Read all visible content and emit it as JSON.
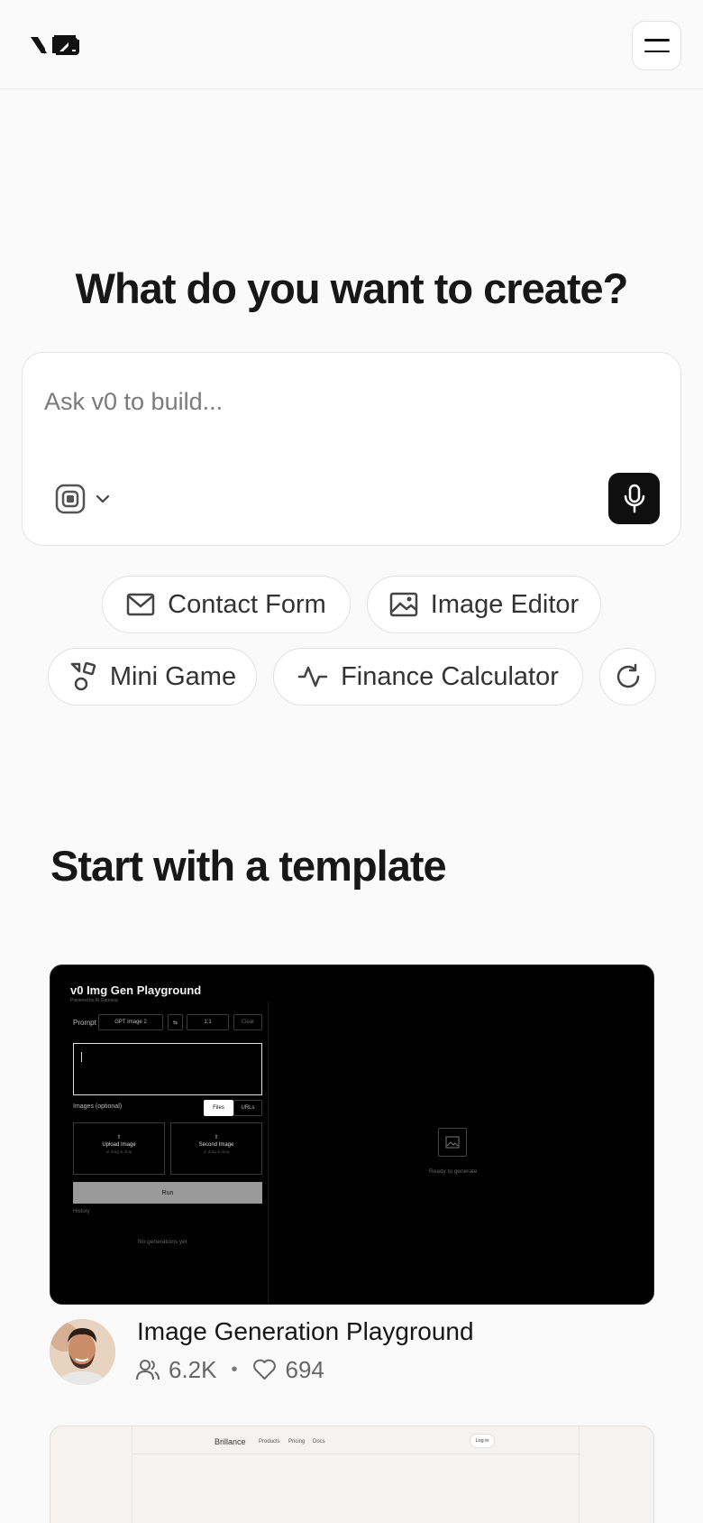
{
  "header": {
    "logo_text": "v0",
    "menu_icon": "hamburger-icon"
  },
  "hero": {
    "title": "What do you want to create?",
    "prompt_placeholder": "Ask v0 to build...",
    "model_icon": "model-selector-icon",
    "mic_icon": "microphone-icon"
  },
  "suggestions": [
    {
      "label": "Contact Form",
      "icon": "mail-icon"
    },
    {
      "label": "Image Editor",
      "icon": "image-icon"
    },
    {
      "label": "Mini Game",
      "icon": "shapes-icon"
    },
    {
      "label": "Finance Calculator",
      "icon": "activity-icon"
    }
  ],
  "refresh_icon": "refresh-icon",
  "templates": {
    "section_title": "Start with a template",
    "cards": [
      {
        "name": "Image Generation Playground",
        "users": "6.2K",
        "likes": "694",
        "preview": {
          "title": "v0 Img Gen Playground",
          "subtitle": "Powered by AI Gateway",
          "prompt_label": "Prompt",
          "model": "GPT Image 2",
          "ratio": "1:1",
          "clear": "Clear",
          "images_label": "Images (optional)",
          "tab_files": "Files",
          "tab_urls": "URLs",
          "upload_1": "Upload Image",
          "upload_2": "Second Image",
          "upload_hint": "or drag & drop",
          "run": "Run",
          "history": "History",
          "empty": "No generations yet",
          "ready": "Ready to generate"
        }
      },
      {
        "preview": {
          "brand": "Brillance",
          "links": [
            "Products",
            "Pricing",
            "Docs"
          ],
          "login": "Log in"
        }
      }
    ]
  },
  "colors": {
    "background": "#fafafa",
    "text": "#171717",
    "accent_dark": "#0f0f0f",
    "border": "#e2e2e2"
  }
}
